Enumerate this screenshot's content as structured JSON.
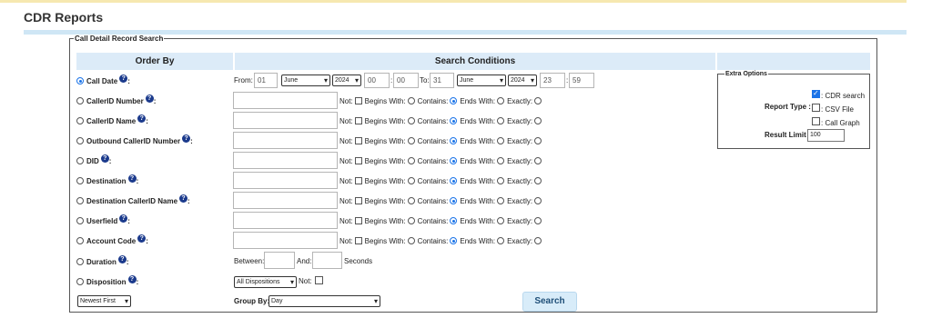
{
  "page": {
    "title": "CDR Reports"
  },
  "fieldset": {
    "legend": "Call Detail Record Search"
  },
  "headers": {
    "order_by": "Order By",
    "search_conditions": "Search Conditions"
  },
  "help": "?",
  "call_date": {
    "label": "Call Date",
    "from_label": "From:",
    "from_day": "01",
    "from_month": "June",
    "from_year": "2024",
    "from_hour": "00",
    "from_min": "00",
    "to_label": "To:",
    "to_day": "31",
    "to_month": "June",
    "to_year": "2024",
    "to_hour": "23",
    "to_min": "59"
  },
  "conditions": {
    "not": "Not:",
    "begins": "Begins With:",
    "contains": "Contains:",
    "ends": "Ends With:",
    "exactly": "Exactly:"
  },
  "rows": [
    {
      "label": "CallerID Number"
    },
    {
      "label": "CallerID Name"
    },
    {
      "label": "Outbound CallerID Number"
    },
    {
      "label": "DID"
    },
    {
      "label": "Destination"
    },
    {
      "label": "Destination CallerID Name"
    },
    {
      "label": "Userfield"
    },
    {
      "label": "Account Code"
    }
  ],
  "duration": {
    "label": "Duration",
    "between": "Between:",
    "and": "And:",
    "seconds": "Seconds"
  },
  "disposition": {
    "label": "Disposition",
    "select": "All Dispositions",
    "not": "Not:"
  },
  "sort": {
    "value": "Newest First"
  },
  "group_by": {
    "label": "Group By:",
    "value": "Day"
  },
  "search_button": "Search",
  "extra_options": {
    "legend": "Extra Options",
    "report_type_label": "Report Type :",
    "cdr_search": ": CDR search",
    "csv_file": ": CSV File",
    "call_graph": ": Call Graph",
    "result_limit_label": "Result Limit :",
    "result_limit": "100"
  },
  "colors": {
    "header_bg": "#dcebf8",
    "accent": "#1a73e8",
    "button_bg": "#d8ecf9"
  }
}
